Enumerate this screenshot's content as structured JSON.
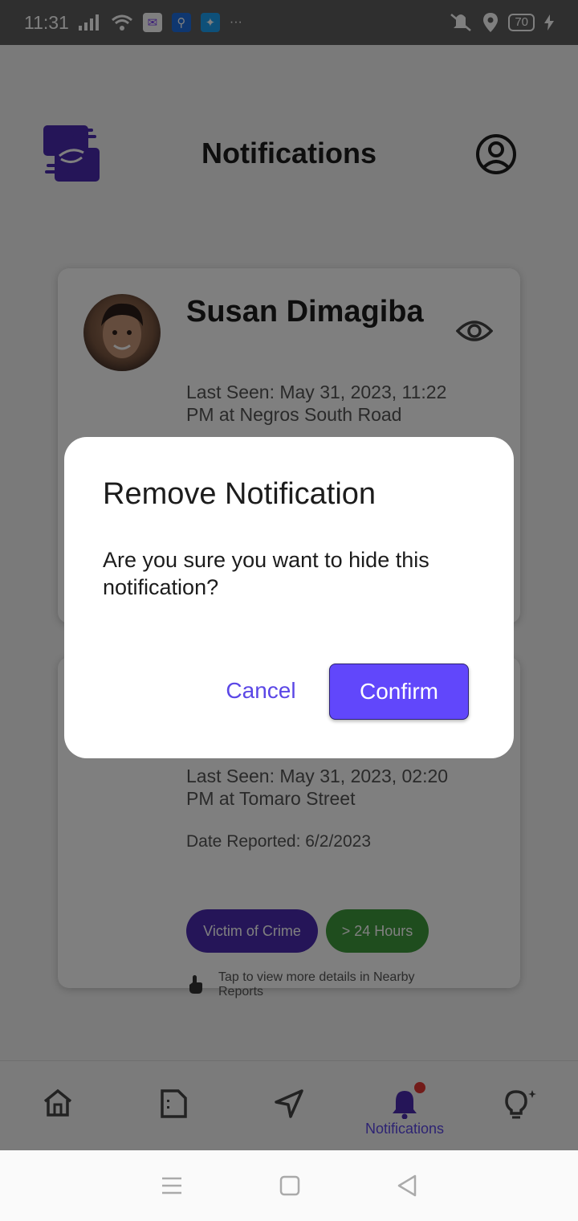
{
  "status_bar": {
    "time": "11:31",
    "more": "···",
    "battery": "70"
  },
  "header": {
    "title": "Notifications"
  },
  "cards": [
    {
      "name": "Susan Dimagiba",
      "last_seen": "Last Seen: May 31, 2023, 11:22 PM at Negros South Road"
    },
    {
      "last_seen": "Last Seen: May 31, 2023, 02:20 PM at Tomaro Street",
      "date_reported": "Date Reported: 6/2/2023",
      "tags": [
        "Victim of Crime",
        "> 24 Hours"
      ],
      "tap_hint": "Tap to view more details in Nearby Reports"
    }
  ],
  "bottom_nav": {
    "active_label": "Notifications"
  },
  "dialog": {
    "title": "Remove Notification",
    "message": "Are you sure you want to hide this notification?",
    "cancel": "Cancel",
    "confirm": "Confirm"
  },
  "colors": {
    "accent": "#6147fb",
    "crime_tag": "#4a2bb0",
    "hours_tag": "#3f9a3c"
  }
}
